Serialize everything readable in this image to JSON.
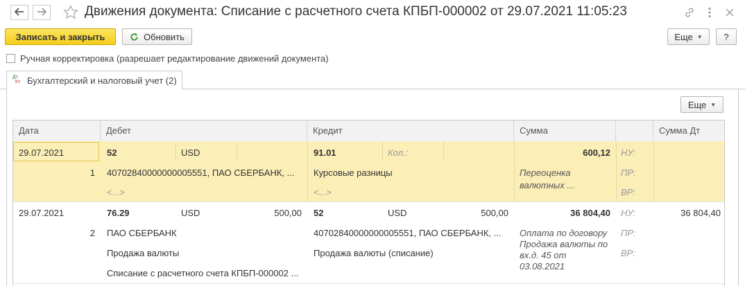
{
  "header": {
    "title": "Движения документа: Списание с расчетного счета КПБП-000002 от 29.07.2021 11:05:23"
  },
  "toolbar": {
    "save_close": "Записать и закрыть",
    "refresh": "Обновить",
    "more": "Еще",
    "help": "?"
  },
  "manual": {
    "label": "Ручная корректировка (разрешает редактирование движений документа)",
    "checked": false
  },
  "tab": {
    "icon_top": "Дт",
    "icon_bottom": "Кт",
    "label": "Бухгалтерский и налоговый учет (2)"
  },
  "grid_toolbar": {
    "more": "Еще"
  },
  "columns": [
    "Дата",
    "Дебет",
    "Кредит",
    "Сумма",
    "Сумма Дт"
  ],
  "rows": [
    {
      "date": "29.07.2021",
      "num": "1",
      "debit_account": "52",
      "debit_currency": "USD",
      "debit_amount": "",
      "debit_sub1": "40702840000000005551, ПАО СБЕРБАНК, ...",
      "debit_sub2": "<...>",
      "debit_sub3": "",
      "credit_account": "91.01",
      "credit_qty_label": "Кол.:",
      "credit_currency": "",
      "credit_amount": "",
      "credit_sub1": "Курсовые разницы",
      "credit_sub2": "<...>",
      "credit_sub3": "",
      "sum": "600,12",
      "content_line1": "Переоценка",
      "content_line2": "валютных ...",
      "content_line3": "",
      "content_line4": "",
      "nu": "НУ:",
      "pr": "ПР:",
      "vr": "ВР:",
      "sum_dt": ""
    },
    {
      "date": "29.07.2021",
      "num": "2",
      "debit_account": "76.29",
      "debit_currency": "USD",
      "debit_amount": "500,00",
      "debit_sub1": "ПАО СБЕРБАНК",
      "debit_sub2": "Продажа валюты",
      "debit_sub3": "Списание с расчетного счета КПБП-000002 ...",
      "credit_account": "52",
      "credit_qty_label": "",
      "credit_currency": "USD",
      "credit_amount": "500,00",
      "credit_sub1": "40702840000000005551, ПАО СБЕРБАНК, ...",
      "credit_sub2": "Продажа валюты (списание)",
      "credit_sub3": "",
      "sum": "36 804,40",
      "content_line1": "Оплата по договору",
      "content_line2": "Продажа валюты по",
      "content_line3": "вх.д. 45 от",
      "content_line4": "03.08.2021",
      "nu": "НУ:",
      "pr": "ПР:",
      "vr": "ВР:",
      "sum_dt": "36 804,40"
    }
  ]
}
